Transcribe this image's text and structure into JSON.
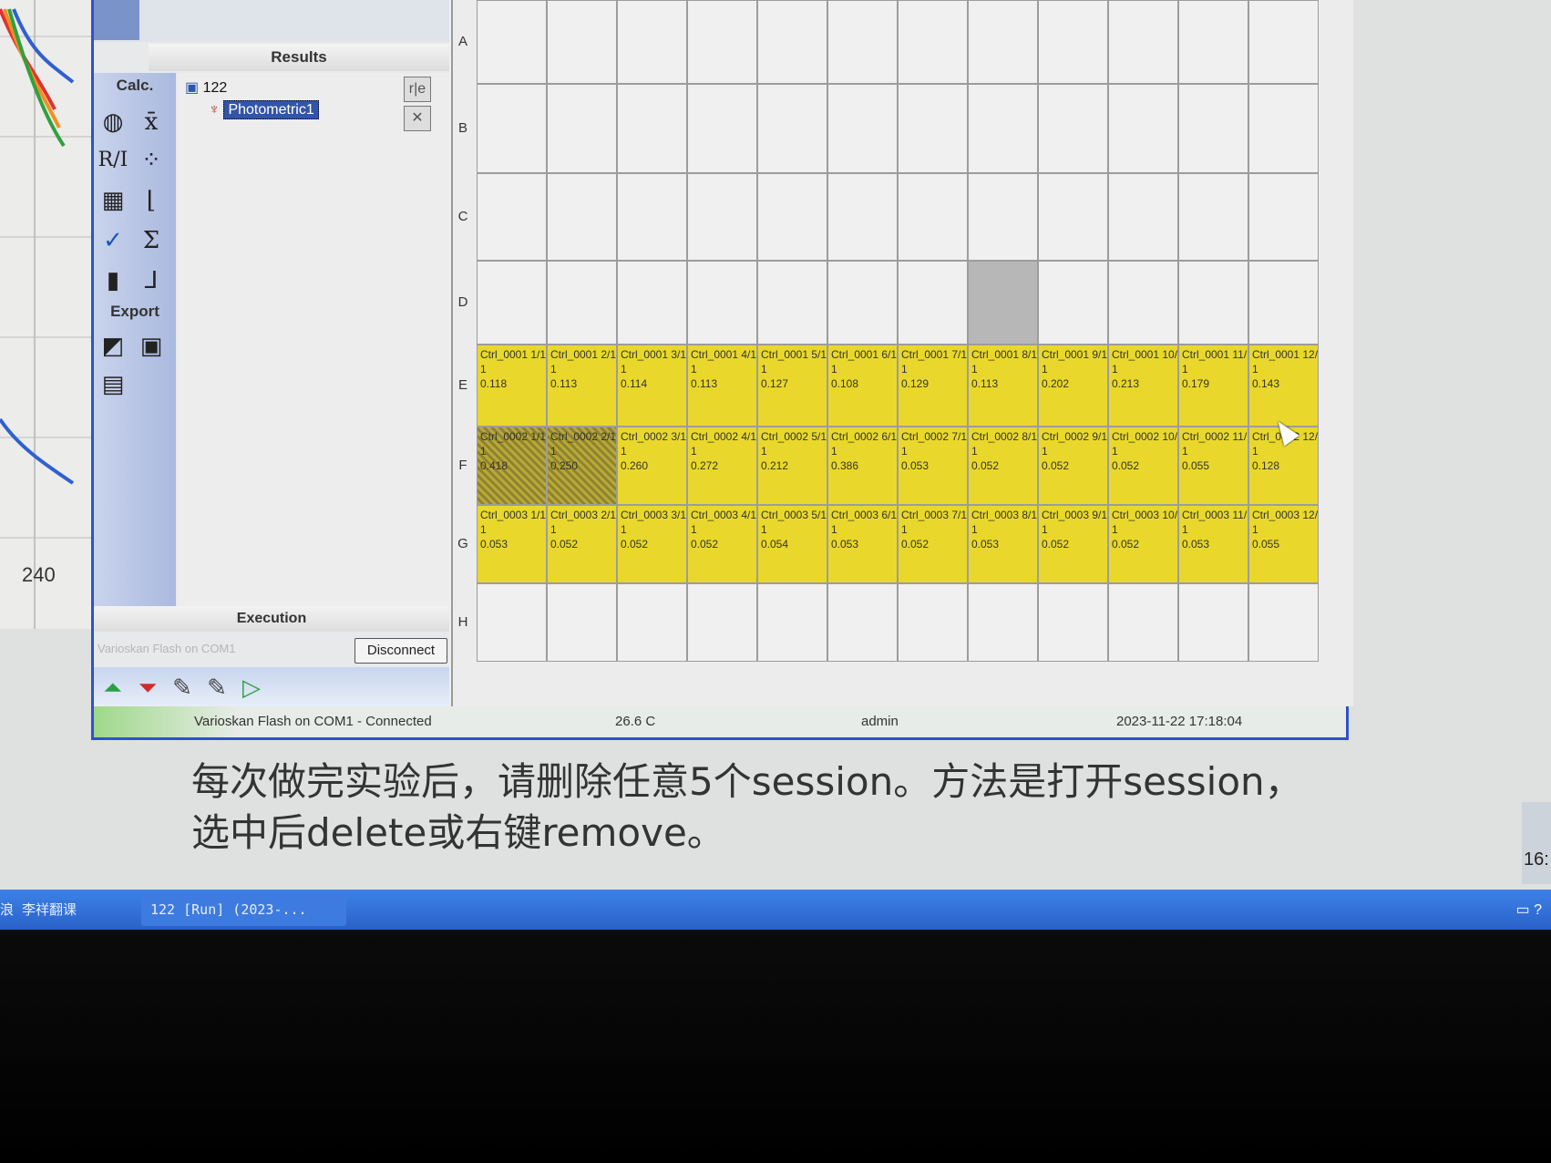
{
  "background_chart": {
    "tick_label": "240"
  },
  "results_panel": {
    "header": "Results",
    "tree": {
      "session": "122",
      "step": "Photometric1"
    }
  },
  "toolbox": {
    "calc_header": "Calc.",
    "export_header": "Export",
    "buttons": [
      "blank-icon",
      "mean-icon",
      "ratio-icon",
      "curve-fit-icon",
      "plate-layout-icon",
      "ed-icon",
      "qc-icon",
      "sum-icon",
      "bar-chart-icon",
      "kinetic-icon"
    ],
    "export_buttons": [
      "export-excel-icon",
      "save-icon",
      "report-icon"
    ]
  },
  "execution": {
    "header": "Execution",
    "instrument_placeholder": "Varioskan Flash on COM1",
    "disconnect_label": "Disconnect",
    "buttons": [
      "load-plate-icon",
      "eject-plate-icon",
      "dispenser-icon",
      "dispenser2-icon",
      "run-icon"
    ]
  },
  "plate": {
    "row_labels": [
      "A",
      "B",
      "C",
      "D",
      "E",
      "F",
      "G",
      "H"
    ],
    "wells": {
      "E": [
        "Ctrl_0001 1/1|0.118",
        "Ctrl_0001 2/1|0.113",
        "Ctrl_0001 3/1|0.114",
        "Ctrl_0001 4/1|0.113",
        "Ctrl_0001 5/1|0.127",
        "Ctrl_0001 6/1|0.108",
        "Ctrl_0001 7/1|0.129",
        "Ctrl_0001 8/1|0.113",
        "Ctrl_0001 9/1|0.202",
        "Ctrl_0001 10/|0.213",
        "Ctrl_0001 11/|0.179",
        "Ctrl_0001 12/|0.143"
      ],
      "F": [
        "Ctrl_0002 1/1|0.418",
        "Ctrl_0002 2/1|0.250",
        "Ctrl_0002 3/1|0.260",
        "Ctrl_0002 4/1|0.272",
        "Ctrl_0002 5/1|0.212",
        "Ctrl_0002 6/1|0.386",
        "Ctrl_0002 7/1|0.053",
        "Ctrl_0002 8/1|0.052",
        "Ctrl_0002 9/1|0.052",
        "Ctrl_0002 10/|0.052",
        "Ctrl_0002 11/|0.055",
        "Ctrl_0002 12/|0.128"
      ],
      "G": [
        "Ctrl_0003 1/1|0.053",
        "Ctrl_0003 2/1|0.052",
        "Ctrl_0003 3/1|0.052",
        "Ctrl_0003 4/1|0.052",
        "Ctrl_0003 5/1|0.054",
        "Ctrl_0003 6/1|0.053",
        "Ctrl_0003 7/1|0.052",
        "Ctrl_0003 8/1|0.053",
        "Ctrl_0003 9/1|0.052",
        "Ctrl_0003 10/|0.052",
        "Ctrl_0003 11/|0.053",
        "Ctrl_0003 12/|0.055"
      ]
    },
    "replicate": "1",
    "colors": {
      "sample": "#e9d82b",
      "empty": "#f0f0f0",
      "selected": "#b7b7b7"
    }
  },
  "status_bar": {
    "connection": "Varioskan Flash on COM1 - Connected",
    "temperature": "26.6 C",
    "user": "admin",
    "datetime": "2023-11-22 17:18:04"
  },
  "document": {
    "line1": "每次做完实验后，请删除任意5个session。方法是打开session，",
    "line2": "选中后delete或右键remove。"
  },
  "taskbar": {
    "left_text": "浪 李祥翻课",
    "task_label": "122 [Run] (2023-...",
    "clock_partial": "16:"
  }
}
